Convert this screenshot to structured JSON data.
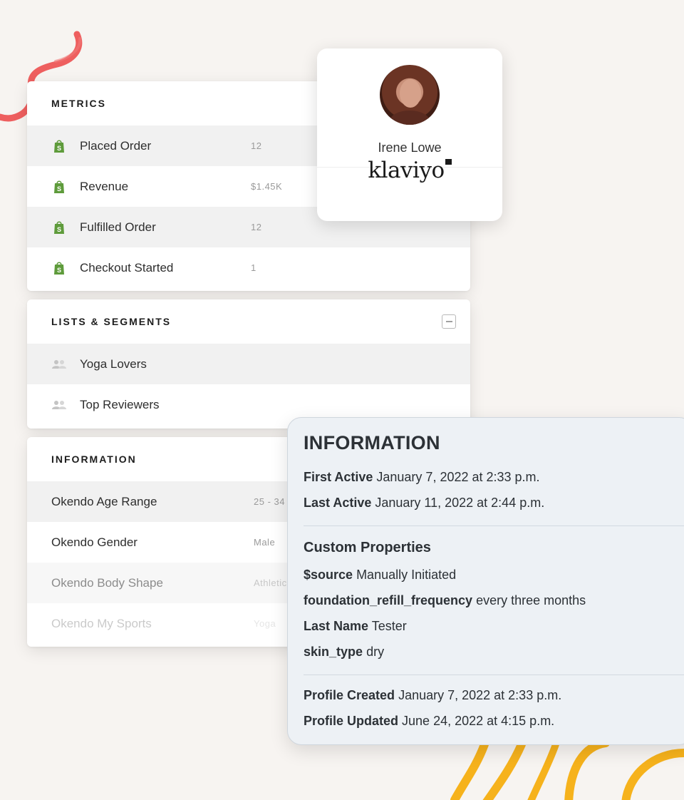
{
  "metrics": {
    "title": "METRICS",
    "items": [
      {
        "label": "Placed Order",
        "value": "12"
      },
      {
        "label": "Revenue",
        "value": "$1.45K"
      },
      {
        "label": "Fulfilled Order",
        "value": "12"
      },
      {
        "label": "Checkout Started",
        "value": "1"
      }
    ]
  },
  "lists": {
    "title": "LISTS & SEGMENTS",
    "items": [
      {
        "label": "Yoga Lovers"
      },
      {
        "label": "Top Reviewers"
      }
    ]
  },
  "information_list": {
    "title": "INFORMATION",
    "items": [
      {
        "label": "Okendo Age Range",
        "value": "25 - 34"
      },
      {
        "label": "Okendo Gender",
        "value": "Male"
      },
      {
        "label": "Okendo Body Shape",
        "value": "Athletic"
      },
      {
        "label": "Okendo My Sports",
        "value": "Yoga"
      }
    ]
  },
  "profile": {
    "name": "Irene Lowe",
    "brand": "klaviyo"
  },
  "information_popup": {
    "title": "INFORMATION",
    "first_active": {
      "label": "First Active",
      "value": "January 7, 2022 at 2:33 p.m."
    },
    "last_active": {
      "label": "Last Active",
      "value": "January 11, 2022 at 2:44 p.m."
    },
    "custom_title": "Custom Properties",
    "properties": [
      {
        "label": "$source",
        "value": "Manually Initiated"
      },
      {
        "label": "foundation_refill_frequency",
        "value": "every three months"
      },
      {
        "label": "Last Name",
        "value": "Tester"
      },
      {
        "label": "skin_type",
        "value": "dry"
      }
    ],
    "profile_created": {
      "label": "Profile Created",
      "value": "January 7, 2022 at 2:33 p.m."
    },
    "profile_updated": {
      "label": "Profile Updated",
      "value": "June 24, 2022 at 4:15 p.m."
    }
  },
  "colors": {
    "background": "#f7f4f1",
    "shopify_green": "#5e9b3b",
    "decor_red": "#ec4f4f",
    "decor_yellow": "#f6b21c",
    "popup_bg": "#edf1f5"
  },
  "icons": {
    "metric": "shopify-bag-icon",
    "segment": "people-group-icon",
    "collapse": "minus-square-icon"
  }
}
